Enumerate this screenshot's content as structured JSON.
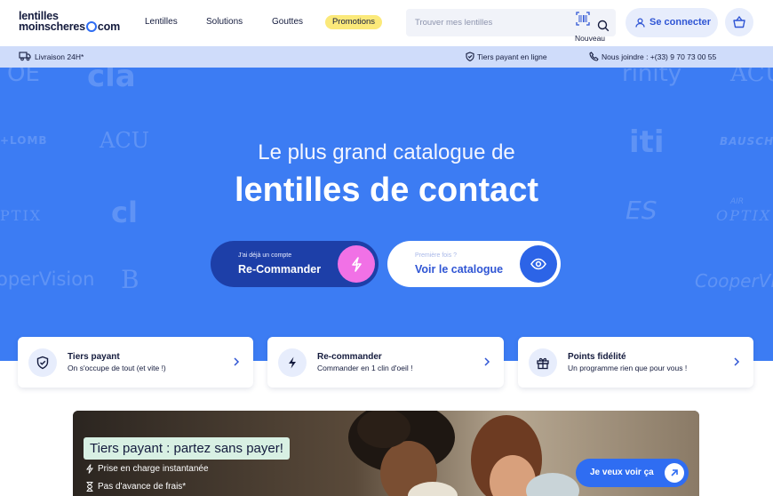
{
  "header": {
    "logo_line1": "lentilles",
    "logo_line2a": "moinscheres",
    "logo_line2b": "com",
    "nav": [
      "Lentilles",
      "Solutions",
      "Gouttes"
    ],
    "promo_label": "Promotions",
    "search_placeholder": "Trouver mes lentilles",
    "scan_badge": "Nouveau",
    "login_label": "Se connecter"
  },
  "infobar": {
    "delivery": "Livraison 24H*",
    "tiers": "Tiers payant en ligne",
    "contact": "Nous joindre : +(33) 9 70 73 00 55"
  },
  "hero": {
    "line1": "Le plus grand catalogue de",
    "line2": "lentilles de contact",
    "reorder_small": "J'ai déjà un compte",
    "reorder_big": "Re-Commander",
    "catalog_small": "Première fois ?",
    "catalog_big": "Voir le catalogue",
    "brands": [
      "OE",
      "cla",
      "rinity",
      "ACU",
      "+LOMB",
      "ACU",
      "iti",
      "BAUSCH",
      "PTIX",
      "cl",
      "ES",
      "OPTIX",
      "operVision",
      "B",
      "CooperVis",
      "AIR"
    ]
  },
  "cards": [
    {
      "title": "Tiers payant",
      "sub": "On s'occupe de tout (et vite !)",
      "icon": "shield-check-icon"
    },
    {
      "title": "Re-commander",
      "sub": "Commander en 1 clin d'oeil !",
      "icon": "lightning-icon"
    },
    {
      "title": "Points fidélité",
      "sub": "Un programme rien que pour vous !",
      "icon": "gift-icon"
    }
  ],
  "banner": {
    "title": "Tiers payant : partez sans payer!",
    "feat1": "Prise en charge instantanée",
    "feat2": "Pas d'avance de frais*",
    "cta": "Je veux voir ça"
  },
  "colors": {
    "primary": "#3c7cf3",
    "dark_button": "#1d3fa8",
    "accent_pink": "#f171e6",
    "promo_yellow": "#fbe97a",
    "infobar": "#cfdcfa"
  }
}
